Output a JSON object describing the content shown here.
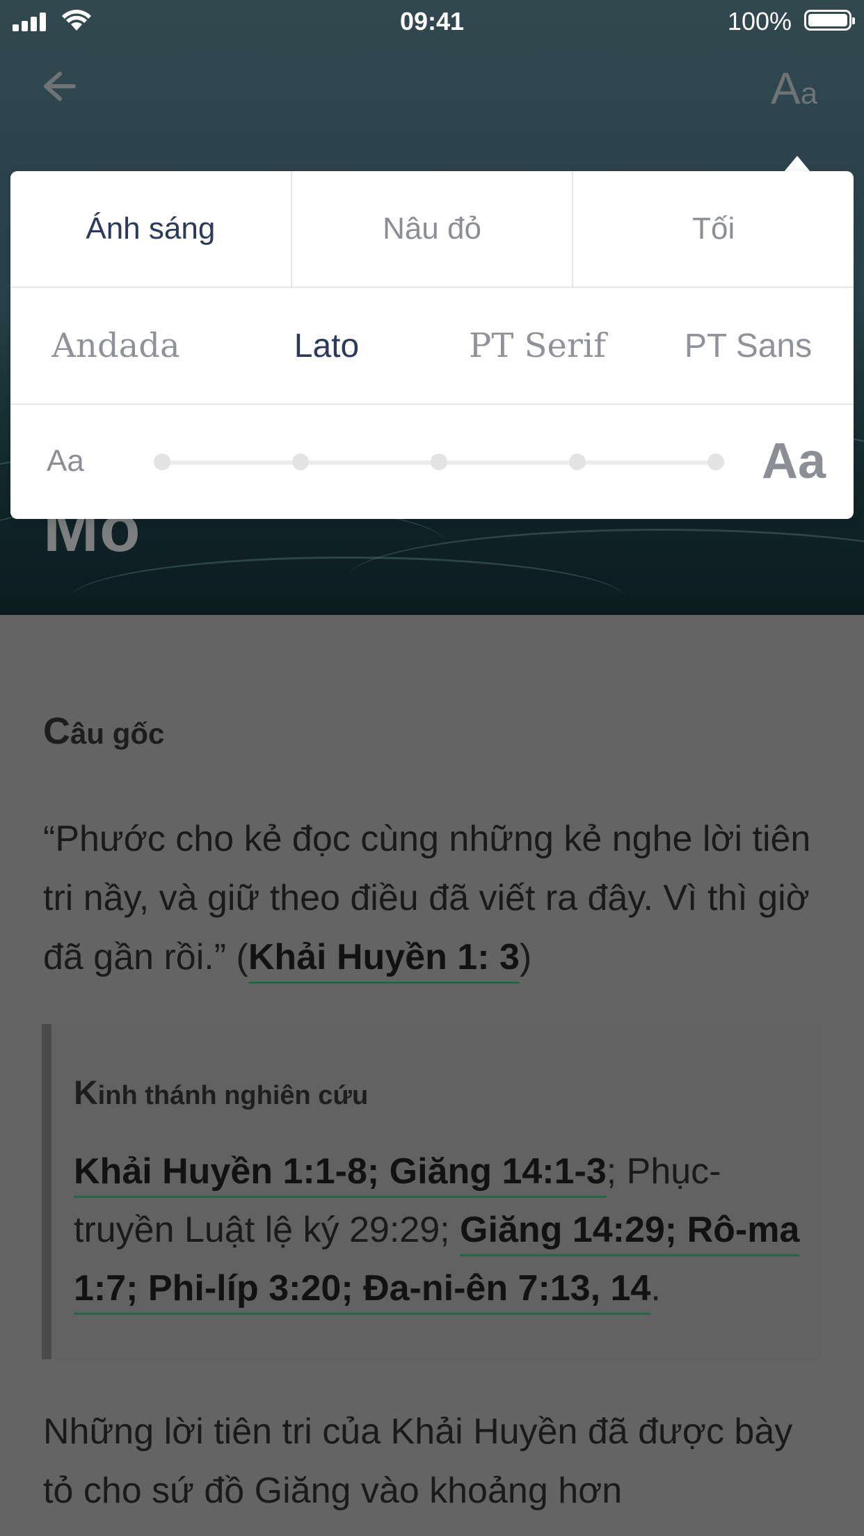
{
  "status_bar": {
    "time": "09:41",
    "battery": "100%"
  },
  "nav": {
    "back_icon": "arrow-left-icon",
    "font_button": {
      "big": "A",
      "small": "a"
    }
  },
  "hero": {
    "title_fragment": "Mo"
  },
  "popover": {
    "themes": [
      {
        "label": "Ánh sáng",
        "active": true
      },
      {
        "label": "Nâu đỏ",
        "active": false
      },
      {
        "label": "Tối",
        "active": false
      }
    ],
    "fonts": [
      {
        "label": "Andada",
        "active": false
      },
      {
        "label": "Lato",
        "active": true
      },
      {
        "label": "PT Serif",
        "active": false
      },
      {
        "label": "PT Sans",
        "active": false
      }
    ],
    "size": {
      "small_label": "Aa",
      "large_label": "Aa",
      "steps": 5
    }
  },
  "content": {
    "key_heading": {
      "cap1": "C",
      "rest1": "âu ",
      "cap2": "g",
      "rest2": "ốc"
    },
    "key_text": "“Phước cho kẻ đọc cùng những kẻ nghe lời tiên tri nầy, và giữ theo điều đã viết ra đây. Vì thì giờ đã gần rồi.” (",
    "key_ref": "Khải Huyền 1: 3",
    "key_close": ")",
    "study_title": {
      "cap": "K",
      "rest": "inh thánh nghiên cứu"
    },
    "study_ref1": "Khải Huyền 1:1-8; Giăng 14:1-3",
    "study_mid": "; Phục-truyền Luật lệ ký 29:29; ",
    "study_ref2": "Giăng 14:29; Rô-ma 1:7; Phi-líp 3:20; Đa-ni-ên 7:13, 14",
    "study_end": ".",
    "para2": "Những lời tiên tri của Khải Huyền đã được bày tỏ cho sứ đồ Giăng vào khoảng hơn"
  },
  "colors": {
    "accent": "#2b3a5c",
    "link_underline": "#1f6a45",
    "overlay": "#646464"
  }
}
